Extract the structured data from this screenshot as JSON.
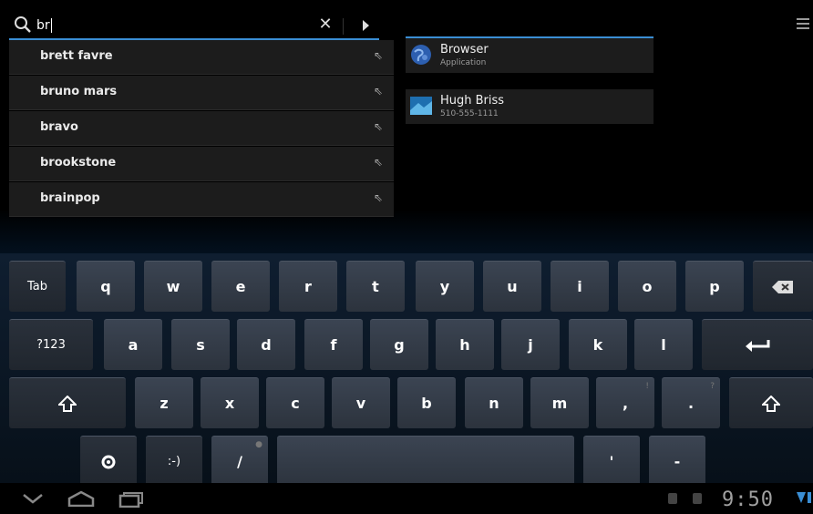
{
  "search": {
    "query": "br"
  },
  "suggestions": [
    {
      "text": "brett favre"
    },
    {
      "text": "bruno mars"
    },
    {
      "text": "bravo"
    },
    {
      "text": "brookstone"
    },
    {
      "text": "brainpop"
    }
  ],
  "results": [
    {
      "title": "Browser",
      "subtitle": "Application",
      "icon": "globe-icon"
    },
    {
      "title": "Hugh Briss",
      "subtitle": "510-555-1111",
      "icon": "contact-icon"
    }
  ],
  "keyboard": {
    "row1": [
      "Tab",
      "q",
      "w",
      "e",
      "r",
      "t",
      "y",
      "u",
      "i",
      "o",
      "p"
    ],
    "row2": [
      "?123",
      "a",
      "s",
      "d",
      "f",
      "g",
      "h",
      "j",
      "k",
      "l"
    ],
    "row3": [
      "z",
      "x",
      "c",
      "v",
      "b",
      "n",
      "m",
      ",",
      "."
    ],
    "row3_hints": {
      ",": "!",
      ".": "?"
    },
    "row4": [
      ":-)",
      "/",
      "'",
      "-"
    ]
  },
  "status": {
    "time": "9:50"
  },
  "colors": {
    "accent": "#3a8ed4",
    "key": "#333b46",
    "background": "#000000"
  }
}
